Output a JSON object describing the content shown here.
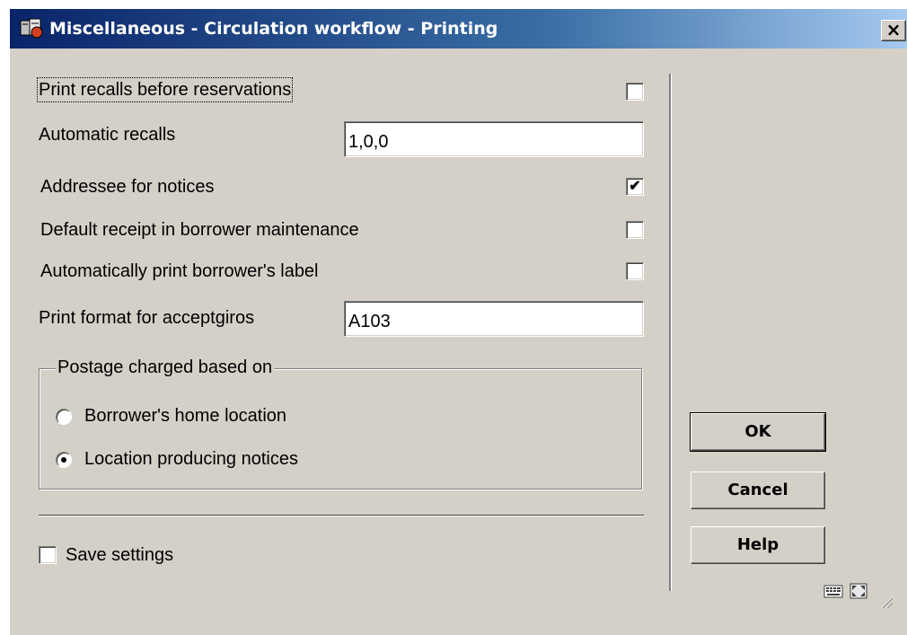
{
  "window": {
    "title": "Miscellaneous - Circulation workflow - Printing",
    "close_label": "×",
    "titlebar_color": "#0a246a"
  },
  "form": {
    "print_recalls_before_reservations": {
      "label": "Print recalls before reservations",
      "checked": false
    },
    "automatic_recalls": {
      "label": "Automatic recalls",
      "value": "1,0,0"
    },
    "addressee_for_notices": {
      "label": "Addressee for notices",
      "checked": true,
      "check_glyph": "✔"
    },
    "default_receipt": {
      "label": "Default receipt in borrower maintenance",
      "checked": false
    },
    "auto_print_label": {
      "label": "Automatically print borrower's label",
      "checked": false
    },
    "print_format_acceptgiros": {
      "label": "Print format for acceptgiros",
      "value": "A103"
    }
  },
  "postage": {
    "title": "Postage charged based on",
    "options": [
      {
        "label": "Borrower's home location",
        "selected": false
      },
      {
        "label": "Location producing notices",
        "selected": true
      }
    ]
  },
  "save_settings": {
    "label": "Save settings",
    "checked": false
  },
  "buttons": {
    "ok": "OK",
    "cancel": "Cancel",
    "help": "Help"
  },
  "status_icons": [
    "keyboard-icon",
    "expand-icon",
    "resize-grip-icon"
  ]
}
